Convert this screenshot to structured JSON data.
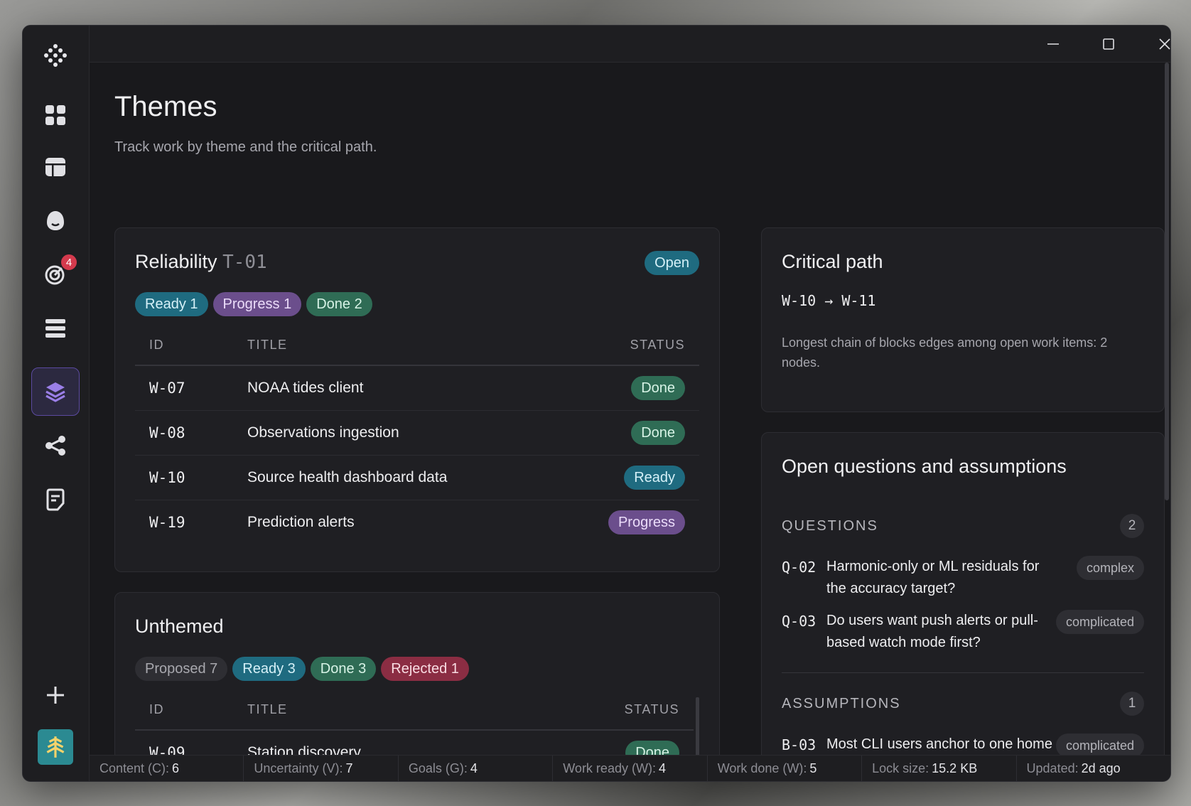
{
  "badges": {
    "goals_count": "4"
  },
  "page": {
    "title": "Themes",
    "subtitle": "Track work by theme and the critical path."
  },
  "reliability": {
    "name": "Reliability",
    "theme_id": "T-01",
    "state": "Open",
    "pills": {
      "ready": "Ready 1",
      "progress": "Progress 1",
      "done": "Done 2"
    },
    "headers": {
      "id": "ID",
      "title": "TITLE",
      "status": "STATUS"
    },
    "rows": [
      {
        "id": "W-07",
        "title": "NOAA tides client",
        "status": "Done"
      },
      {
        "id": "W-08",
        "title": "Observations ingestion",
        "status": "Done"
      },
      {
        "id": "W-10",
        "title": "Source health dashboard data",
        "status": "Ready"
      },
      {
        "id": "W-19",
        "title": "Prediction alerts",
        "status": "Progress"
      }
    ]
  },
  "unthemed": {
    "name": "Unthemed",
    "pills": {
      "proposed": "Proposed 7",
      "ready": "Ready 3",
      "done": "Done 3",
      "rejected": "Rejected 1"
    },
    "headers": {
      "id": "ID",
      "title": "TITLE",
      "status": "STATUS"
    },
    "rows": [
      {
        "id": "W-09",
        "title": "Station discovery",
        "status": "Done"
      }
    ]
  },
  "critical_path": {
    "title": "Critical path",
    "from": "W-10",
    "arrow": "→",
    "to": "W-11",
    "description": "Longest chain of blocks edges among open work items: 2 nodes."
  },
  "open_questions": {
    "title": "Open questions and assumptions",
    "questions_label": "QUESTIONS",
    "questions_count": "2",
    "questions": [
      {
        "id": "Q-02",
        "text": "Harmonic-only or ML residuals for the accuracy target?",
        "tag": "complex"
      },
      {
        "id": "Q-03",
        "text": "Do users want push alerts or pull-based watch mode first?",
        "tag": "complicated"
      }
    ],
    "assumptions_label": "ASSUMPTIONS",
    "assumptions_count": "1",
    "assumptions": [
      {
        "id": "B-03",
        "text": "Most CLI users anchor to one home station",
        "tag": "complicated"
      }
    ]
  },
  "statusbar": [
    {
      "label": "Content (C):",
      "value": "6"
    },
    {
      "label": "Uncertainty (V):",
      "value": "7"
    },
    {
      "label": "Goals (G):",
      "value": "4"
    },
    {
      "label": "Work ready (W):",
      "value": "4"
    },
    {
      "label": "Work done (W):",
      "value": "5"
    },
    {
      "label": "Lock size:",
      "value": "15.2 KB"
    },
    {
      "label": "Updated:",
      "value": "2d ago"
    }
  ],
  "colors": {
    "accent": "#5b4aa0",
    "ready": "#1f6b80",
    "progress": "#6b4e8c",
    "done": "#2f6c55",
    "rejected": "#8b2d43"
  }
}
